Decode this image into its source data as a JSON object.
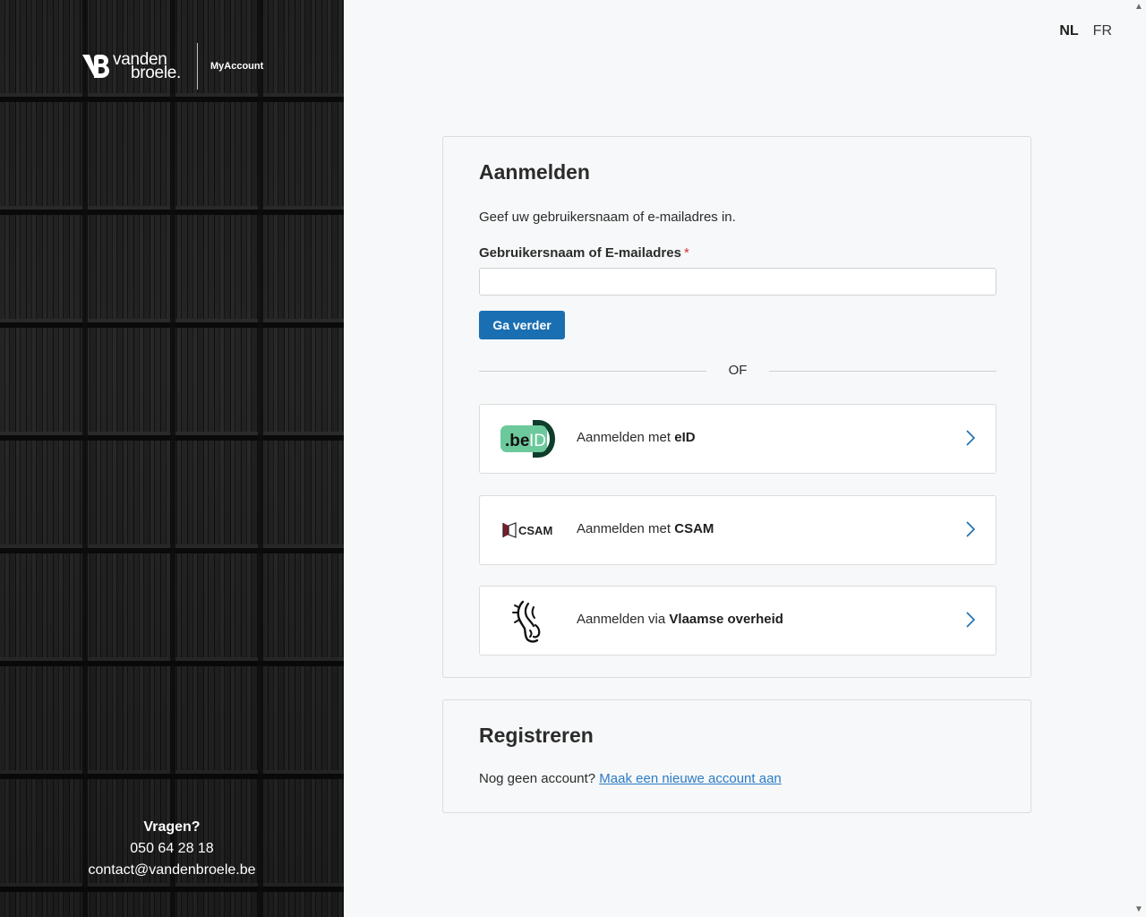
{
  "brand": {
    "logo_line1": "vanden",
    "logo_line2": "broele.",
    "subtitle": "MyAccount"
  },
  "contact": {
    "heading": "Vragen?",
    "phone": "050 64 28 18",
    "email": "contact@vandenbroele.be"
  },
  "language": {
    "options": [
      "NL",
      "FR"
    ],
    "active": "NL"
  },
  "login": {
    "title": "Aanmelden",
    "intro": "Geef uw gebruikersnaam of e-mailadres in.",
    "field_label": "Gebruikersnaam of E-mailadres",
    "required_marker": "*",
    "field_value": "",
    "continue_label": "Ga verder",
    "separator": "OF",
    "providers": [
      {
        "prefix": "Aanmelden met ",
        "name": "eID",
        "icon": "beid-logo-icon"
      },
      {
        "prefix": "Aanmelden met ",
        "name": "CSAM",
        "icon": "csam-logo-icon",
        "icon_text": "CSAM"
      },
      {
        "prefix": "Aanmelden via ",
        "name": "Vlaamse overheid",
        "icon": "vlaamse-leeuw-icon"
      }
    ]
  },
  "register": {
    "title": "Registreren",
    "prompt": "Nog geen account?",
    "link_label": "Maak een nieuwe account aan"
  },
  "colors": {
    "primary": "#1a6fb2",
    "link": "#2b7cc5",
    "required": "#d0362f",
    "beid_green": "#6cc99b",
    "beid_dark": "#0f3d2b"
  }
}
